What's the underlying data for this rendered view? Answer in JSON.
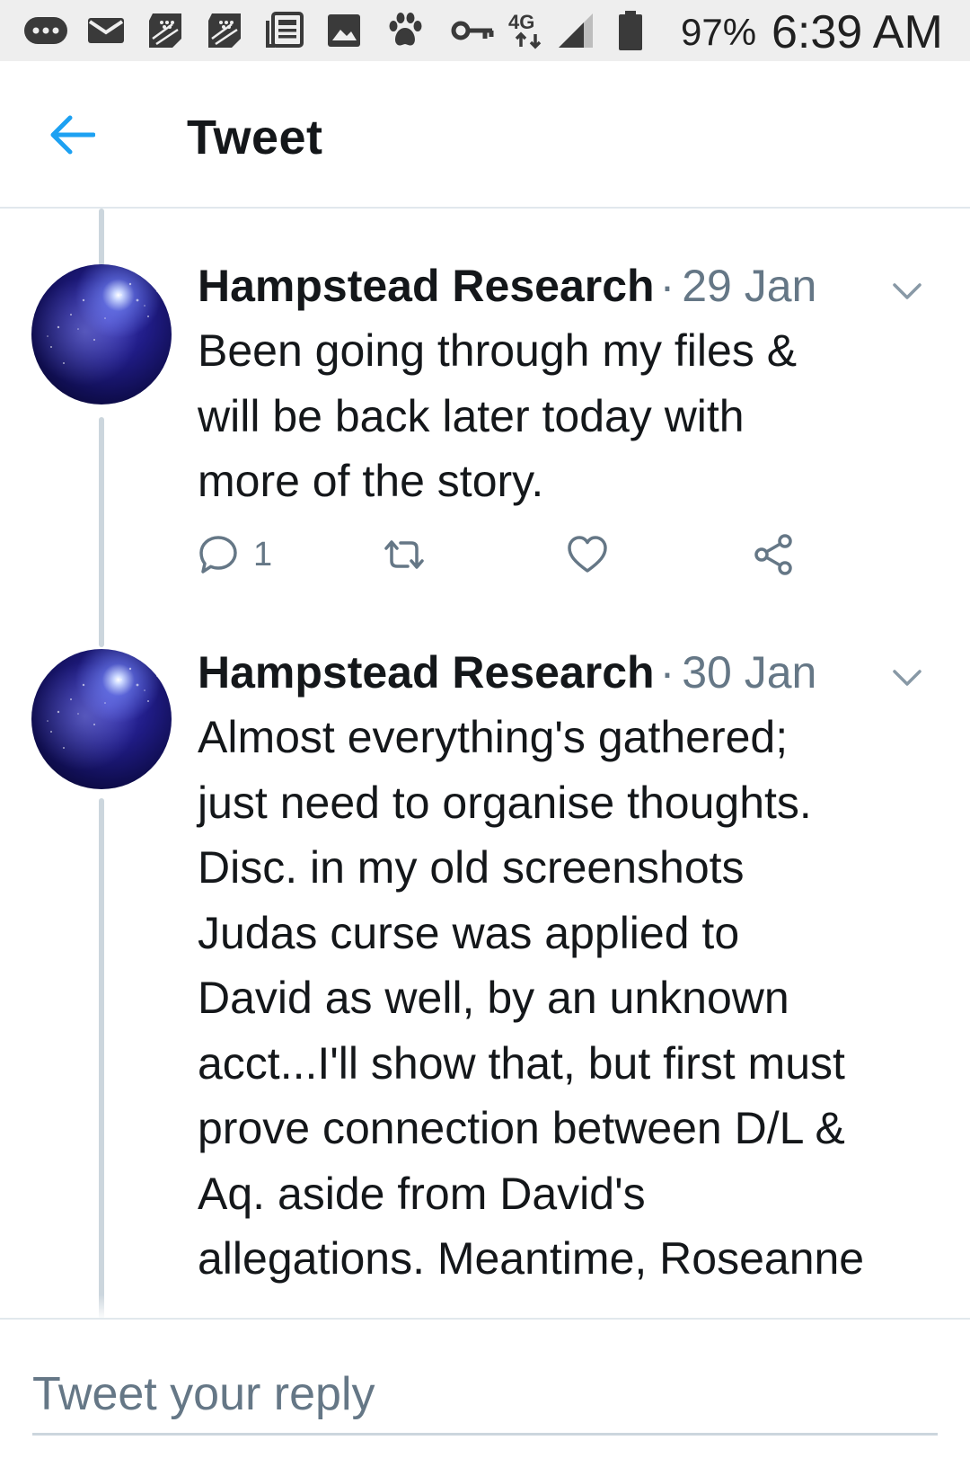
{
  "status_bar": {
    "network": "4G",
    "battery_percent": "97%",
    "time": "6:39 AM",
    "icons": [
      "more-icon",
      "mail-icon",
      "blackberry-icon",
      "blackberry-icon",
      "news-icon",
      "image-icon",
      "paw-icon",
      "key-icon",
      "network-4g-icon",
      "signal-icon",
      "battery-icon"
    ]
  },
  "header": {
    "title": "Tweet",
    "back_icon": "back-arrow-icon"
  },
  "tweets": [
    {
      "author": "Hampstead Research",
      "separator": "·",
      "date": "29 Jan",
      "text": "Been going through my files &\nwill be back later today with\nmore of the story.",
      "actions": {
        "reply_count": "1",
        "retweet_count": "",
        "like_count": ""
      }
    },
    {
      "author": "Hampstead Research",
      "separator": "·",
      "date": "30 Jan",
      "text": "Almost everything's gathered;\njust need to organise thoughts.\nDisc. in my old screenshots\nJudas curse was applied to\nDavid as well, by an unknown\nacct...I'll show that, but first must\nprove connection between D/L &\nAq. aside from David's\nallegations. Meantime, Roseanne"
    }
  ],
  "compose": {
    "placeholder": "Tweet your reply"
  },
  "colors": {
    "accent": "#1da1f2",
    "text_primary": "#14171a",
    "text_secondary": "#657786",
    "thread_line": "#ccd6dd",
    "status_bar_bg": "#eeeeee"
  }
}
